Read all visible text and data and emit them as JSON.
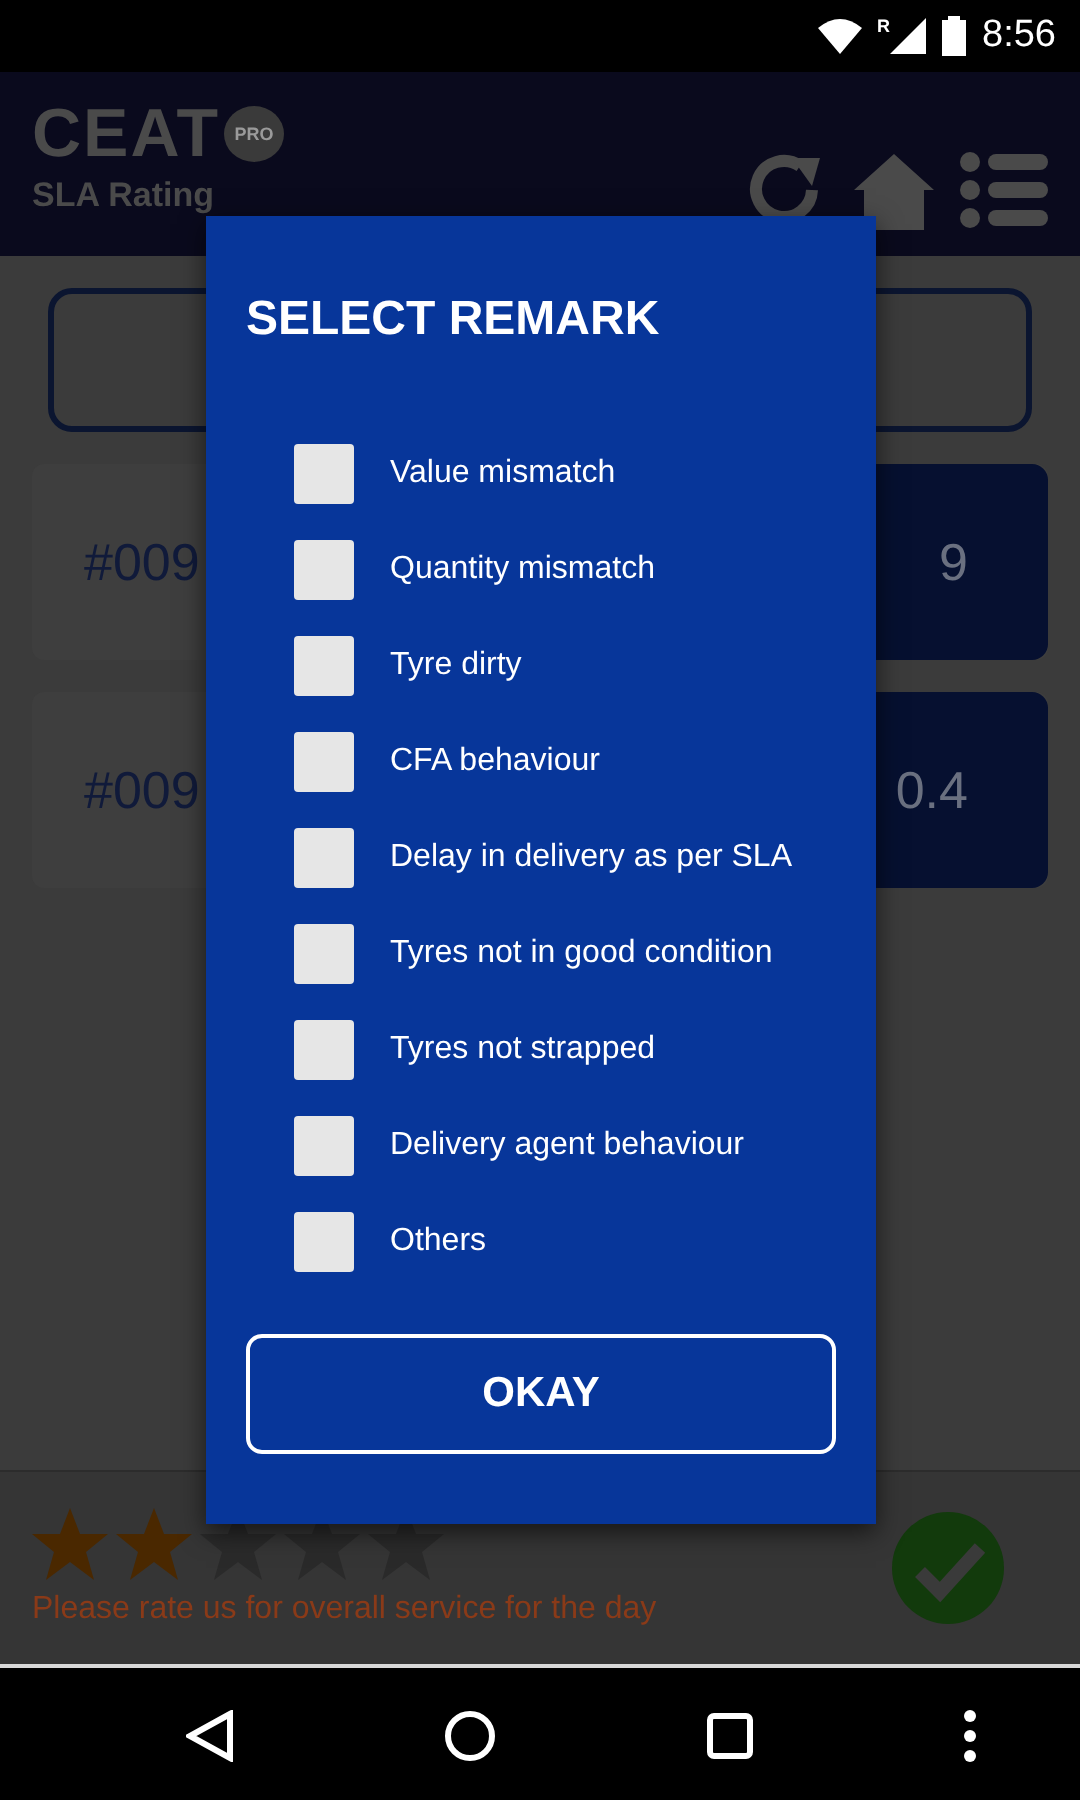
{
  "status_bar": {
    "time": "8:56",
    "roaming": "R"
  },
  "header": {
    "logo": "CEAT",
    "logo_badge": "PRO",
    "subtitle": "SLA Rating"
  },
  "orders": [
    {
      "number": "#009",
      "value": "9"
    },
    {
      "number": "#009",
      "value": "0.4"
    }
  ],
  "rating": {
    "stars": 2,
    "prompt": "Please rate us for overall service for the day"
  },
  "dialog": {
    "title": "SELECT REMARK",
    "options": [
      {
        "label": "Value mismatch",
        "checked": false
      },
      {
        "label": "Quantity mismatch",
        "checked": false
      },
      {
        "label": "Tyre dirty",
        "checked": false
      },
      {
        "label": "CFA behaviour",
        "checked": false
      },
      {
        "label": "Delay in delivery as per SLA",
        "checked": false
      },
      {
        "label": "Tyres not in good condition",
        "checked": false
      },
      {
        "label": "Tyres not strapped",
        "checked": false
      },
      {
        "label": "Delivery agent behaviour",
        "checked": false
      },
      {
        "label": "Others",
        "checked": false
      }
    ],
    "button": "OKAY"
  }
}
